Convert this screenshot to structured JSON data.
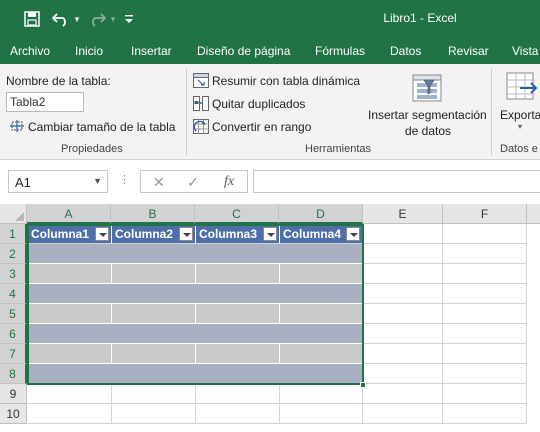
{
  "app": {
    "window_title": "Libro1  -  Excel"
  },
  "qat": {
    "customize_glyph": "▾"
  },
  "ribbon_tabs": [
    "Archivo",
    "Inicio",
    "Insertar",
    "Diseño de página",
    "Fórmulas",
    "Datos",
    "Revisar",
    "Vista"
  ],
  "ribbon": {
    "propiedades": {
      "table_name_label": "Nombre de la tabla:",
      "table_name_value": "Tabla2",
      "resize_label": "Cambiar tamaño de la tabla",
      "group_label": "Propiedades"
    },
    "herramientas": {
      "pivot_label": "Resumir con tabla dinámica",
      "dedupe_label": "Quitar duplicados",
      "convert_label": "Convertir en rango",
      "slicer_line1": "Insertar segmentación",
      "slicer_line2": "de datos",
      "group_label": "Herramientas"
    },
    "datos_externos": {
      "export_label": "Exporta",
      "group_label": "Datos e"
    }
  },
  "formula_bar": {
    "name_box": "A1",
    "dots": "⋮",
    "cancel": "✕",
    "enter": "✓",
    "fx": "fx",
    "value": ""
  },
  "sheet": {
    "columns": [
      "A",
      "B",
      "C",
      "D",
      "E",
      "F"
    ],
    "rows": [
      "1",
      "2",
      "3",
      "4",
      "5",
      "6",
      "7",
      "8",
      "9",
      "10"
    ],
    "table": {
      "headers": [
        "Columna1",
        "Columna2",
        "Columna3",
        "Columna4"
      ]
    }
  },
  "colors": {
    "accent": "#217346",
    "table_header": "#4f6fa8",
    "band_dark": "#a9b0c1",
    "band_light": "#c9c9c9"
  }
}
